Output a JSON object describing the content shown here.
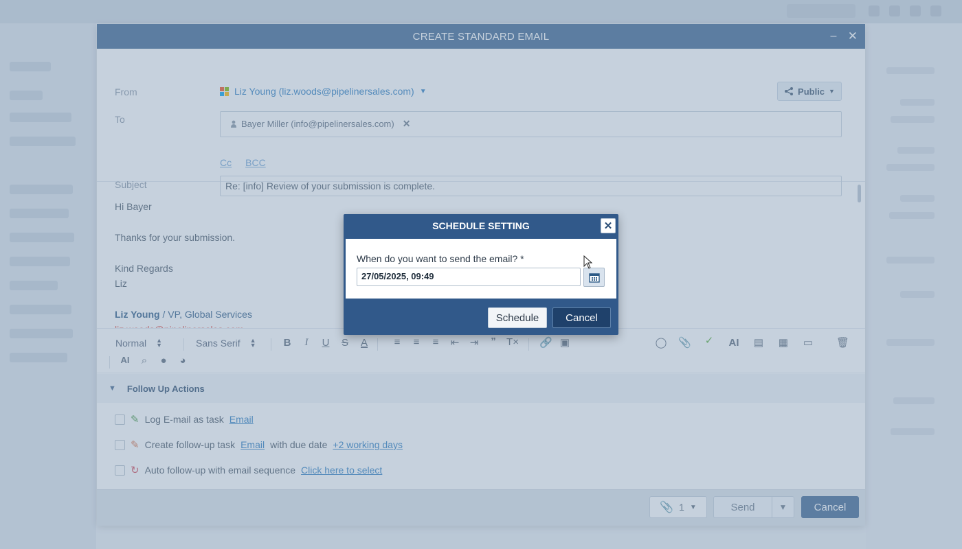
{
  "email": {
    "window_title": "CREATE STANDARD EMAIL",
    "from_label": "From",
    "from_value": "Liz Young (liz.woods@pipelinersales.com)",
    "public_label": "Public",
    "to_label": "To",
    "recipient": "Bayer Miller (info@pipelinersales.com)",
    "cc_label": "Cc",
    "bcc_label": "BCC",
    "subject_label": "Subject",
    "subject_value": "Re: [info] Review of your submission is complete.",
    "body": {
      "greeting": "Hi Bayer",
      "line1": "Thanks for your submission.",
      "closing": "Kind Regards",
      "signoff": "Liz",
      "sig_name": "Liz Young",
      "sig_sep": " / ",
      "sig_role": "VP, Global Services",
      "sig_email": "liz.woods@pipelinersales.com"
    },
    "toolbar": {
      "paragraph_style": "Normal",
      "font": "Sans Serif"
    },
    "followup": {
      "header": "Follow Up Actions",
      "items": [
        {
          "text": "Log E-mail as task",
          "link": "Email"
        },
        {
          "text": "Create follow-up task",
          "link": "Email",
          "middle": "with due date",
          "link2": "+2 working days"
        },
        {
          "text": "Auto follow-up with email sequence",
          "link": "Click here to select"
        }
      ]
    },
    "footer": {
      "attachments_count": "1",
      "send_label": "Send",
      "cancel_label": "Cancel"
    }
  },
  "modal": {
    "title": "SCHEDULE SETTING",
    "question": "When do you want to send the email? *",
    "date_value": "27/05/2025, 09:49",
    "schedule_label": "Schedule",
    "cancel_label": "Cancel"
  },
  "colors": {
    "primary": "#3e6792",
    "modal_header": "#31598a",
    "link": "#2f7fc1",
    "overlay": "#809ab4"
  }
}
